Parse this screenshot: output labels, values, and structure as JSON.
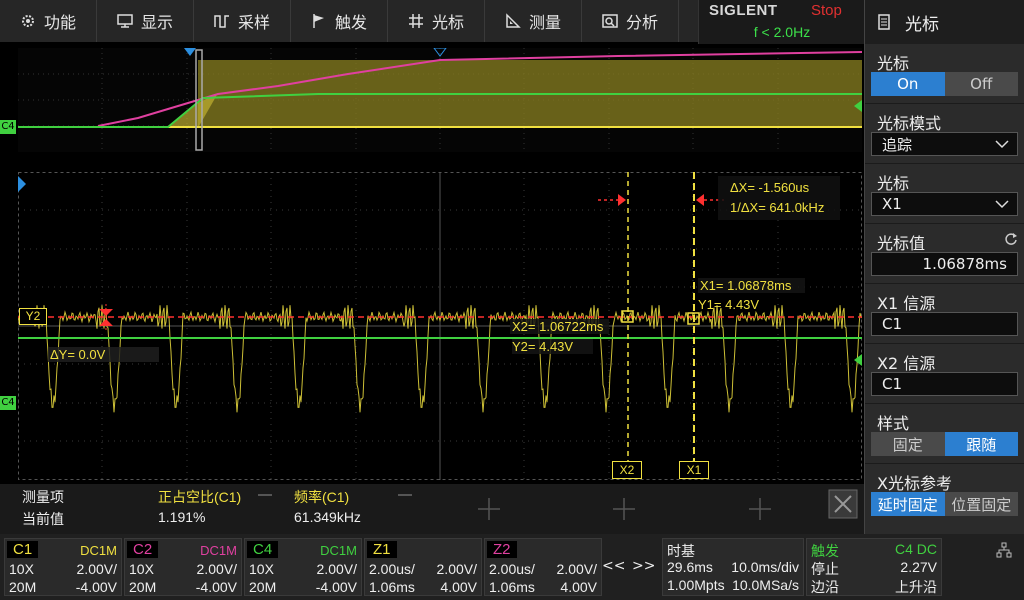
{
  "menu": [
    {
      "label": "功能",
      "icon": "gear-icon"
    },
    {
      "label": "显示",
      "icon": "display-icon"
    },
    {
      "label": "采样",
      "icon": "acquire-icon"
    },
    {
      "label": "触发",
      "icon": "flag-icon"
    },
    {
      "label": "光标",
      "icon": "crosshair-icon"
    },
    {
      "label": "测量",
      "icon": "ruler-icon"
    },
    {
      "label": "分析",
      "icon": "analyze-icon"
    }
  ],
  "brand": {
    "logo": "SIGLENT",
    "state": "Stop",
    "trigger_freq": "f < 2.0Hz"
  },
  "panel": {
    "title": "光标",
    "cursor_label": "光标",
    "on_label": "On",
    "off_label": "Off",
    "mode_label": "光标模式",
    "mode_value": "追踪",
    "cursor_sel_label": "光标",
    "cursor_sel_value": "X1",
    "value_label": "光标值",
    "value": "1.06878ms",
    "x1_src_label": "X1 信源",
    "x1_src": "C1",
    "x2_src_label": "X2 信源",
    "x2_src": "C1",
    "style_label": "样式",
    "style_fixed": "固定",
    "style_follow": "跟随",
    "xref_label": "X光标参考",
    "xref_realtime": "延时固定",
    "xref_pos": "位置固定"
  },
  "scope": {
    "delta_x": "ΔX= -1.560us",
    "inv_delta_x": "1/ΔX= 641.0kHz",
    "x1_readout": "X1= 1.06878ms",
    "y1_readout": "Y1= 4.43V",
    "x2_readout": "X2= 1.06722ms",
    "y2_readout": "Y2= 4.43V",
    "delta_y": "ΔY= 0.0V",
    "y2_tag": "Y2",
    "x1_tag": "X1",
    "x2_tag": "X2",
    "c4_tag": "C4",
    "c4_tag_overview": "C4"
  },
  "measure": {
    "col_head": "测量项",
    "row_head": "当前值",
    "m1_name": "正占空比(C1)",
    "m1_value": "1.191%",
    "m2_name": "频率(C1)",
    "m2_value": "61.349kHz"
  },
  "channels": [
    {
      "name": "C1",
      "coupling": "DC1M",
      "probe": "10X",
      "scale": "2.00V/",
      "bw": "20M",
      "offset": "-4.00V",
      "color": "#f0e040"
    },
    {
      "name": "C2",
      "coupling": "DC1M",
      "probe": "10X",
      "scale": "2.00V/",
      "bw": "20M",
      "offset": "-4.00V",
      "color": "#e040a0"
    },
    {
      "name": "C4",
      "coupling": "DC1M",
      "probe": "10X",
      "scale": "2.00V/",
      "bw": "20M",
      "offset": "-4.00V",
      "color": "#40d040"
    },
    {
      "name": "Z1",
      "coupling": "",
      "probe": "2.00us/",
      "scale": "2.00V/",
      "bw": "1.06ms",
      "offset": "4.00V",
      "color": "#f0e040"
    },
    {
      "name": "Z2",
      "coupling": "",
      "probe": "2.00us/",
      "scale": "2.00V/",
      "bw": "1.06ms",
      "offset": "4.00V",
      "color": "#e040a0"
    }
  ],
  "nav": {
    "prev": "<<",
    "next": ">>"
  },
  "timebase": {
    "title": "时基",
    "delay": "29.6ms",
    "scale": "10.0ms/div",
    "mem": "1.00Mpts",
    "rate": "10.0MSa/s"
  },
  "trigger": {
    "title": "触发",
    "source": "C4 DC",
    "level": "2.27V",
    "status": "停止",
    "type": "边沿",
    "slope": "上升沿"
  },
  "colors": {
    "ch1": "#f0e040",
    "ch2": "#e040a0",
    "ch4": "#40d040",
    "accent": "#2c7fd0",
    "stop": "#e03030"
  }
}
